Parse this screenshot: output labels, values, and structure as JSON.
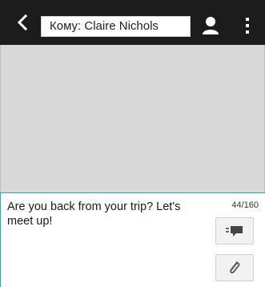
{
  "topbar": {
    "back_icon": "chevron-left-icon",
    "to_field_text": "Кому: Claire Nichols",
    "contact_icon": "person-icon",
    "menu_icon": "more-vert-icon"
  },
  "compose": {
    "message": "Are you back from your trip? Let's meet up!",
    "char_count": "44/160",
    "send_icon": "send-message-icon",
    "attach_icon": "paperclip-icon"
  },
  "colors": {
    "topbar": "#1c1c1c",
    "conversation_bg": "#d9d9d9",
    "accent": "#2d9fd8"
  }
}
